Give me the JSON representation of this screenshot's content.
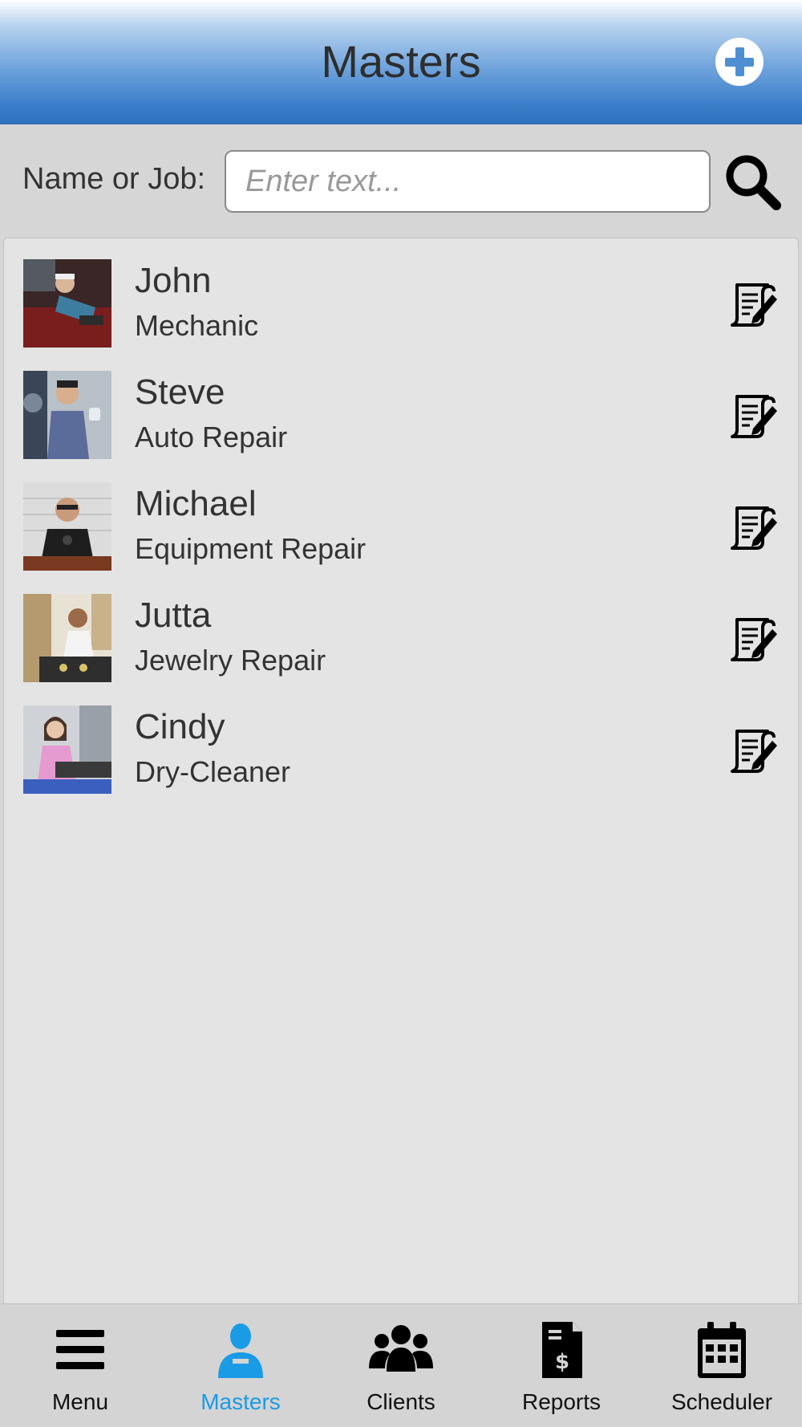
{
  "header": {
    "title": "Masters",
    "add_icon": "plus-circle-icon"
  },
  "search": {
    "label": "Name or Job:",
    "placeholder": "Enter text...",
    "value": "",
    "icon": "search-icon"
  },
  "masters": [
    {
      "name": "John",
      "job": "Mechanic",
      "edit_icon": "edit-note-icon"
    },
    {
      "name": "Steve",
      "job": "Auto Repair",
      "edit_icon": "edit-note-icon"
    },
    {
      "name": "Michael",
      "job": "Equipment Repair",
      "edit_icon": "edit-note-icon"
    },
    {
      "name": "Jutta",
      "job": "Jewelry Repair",
      "edit_icon": "edit-note-icon"
    },
    {
      "name": "Cindy",
      "job": "Dry-Cleaner",
      "edit_icon": "edit-note-icon"
    }
  ],
  "tabs": [
    {
      "label": "Menu",
      "icon": "hamburger-icon",
      "active": false
    },
    {
      "label": "Masters",
      "icon": "worker-icon",
      "active": true
    },
    {
      "label": "Clients",
      "icon": "group-icon",
      "active": false
    },
    {
      "label": "Reports",
      "icon": "invoice-dollar-icon",
      "active": false
    },
    {
      "label": "Scheduler",
      "icon": "calendar-icon",
      "active": false
    }
  ],
  "colors": {
    "header_gradient_bottom": "#2f72bf",
    "active_tab": "#1a9be6",
    "list_background": "#e4e4e4",
    "page_background": "#d6d6d6"
  }
}
